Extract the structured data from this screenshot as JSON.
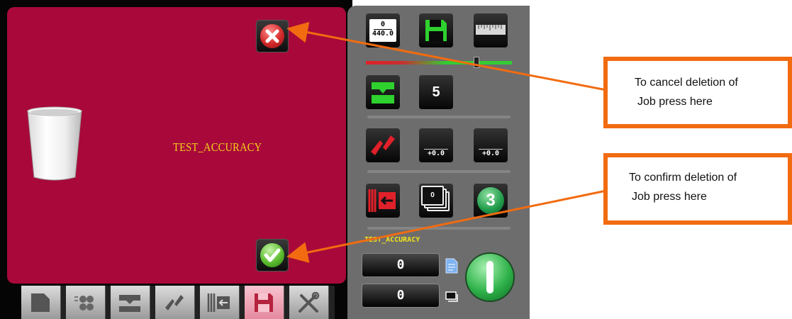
{
  "dialog": {
    "job_name": "TEST_ACCURACY",
    "cancel_icon": "cross-icon",
    "confirm_icon": "checkmark-icon",
    "trash_icon": "trash-can-icon"
  },
  "tabs": [
    {
      "name": "job-tab",
      "icon": "page-icon"
    },
    {
      "name": "rollers-tab",
      "icon": "rollers-icon"
    },
    {
      "name": "gripper-tab",
      "icon": "gripper-icon"
    },
    {
      "name": "blades-tab",
      "icon": "blades-icon"
    },
    {
      "name": "feed-tab",
      "icon": "feed-icon"
    },
    {
      "name": "save-tab",
      "icon": "floppy-disk-icon",
      "active": true
    },
    {
      "name": "tools-tab",
      "icon": "tools-icon"
    }
  ],
  "panel": {
    "size_top": "0",
    "size_value": "440.0",
    "count_value": "5",
    "offset_left": "+0.0",
    "offset_right": "+0.0",
    "stack_value": "0",
    "stage_value": "3",
    "job_label": "TEST_ACCURACY",
    "counter_sheets": "0",
    "counter_stacks": "0"
  },
  "callouts": {
    "cancel_text_line1": "To cancel deletion of",
    "cancel_text_line2": "Job press here",
    "confirm_text_line1": "To confirm deletion of",
    "confirm_text_line2": "Job press here"
  },
  "colors": {
    "dialog_bg": "#a8093a",
    "callout_border": "#f26b10",
    "job_name": "#f2d21a",
    "accent_green": "#33cc33",
    "accent_red": "#e0202a"
  }
}
